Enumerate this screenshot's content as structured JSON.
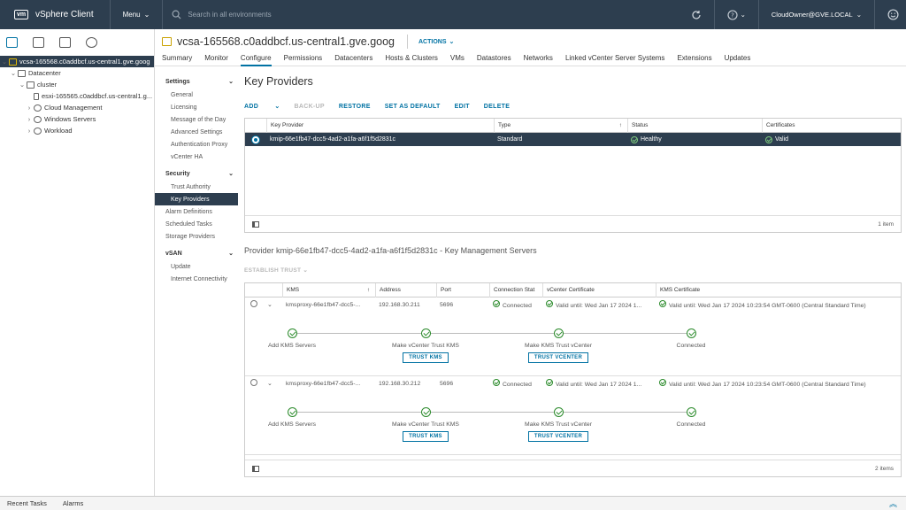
{
  "topbar": {
    "logo": "vm",
    "app_name": "vSphere Client",
    "menu_label": "Menu",
    "search_placeholder": "Search in all environments",
    "user": "CloudOwner@GVE.LOCAL"
  },
  "tree": {
    "items": [
      {
        "label": "vcsa-165568.c0addbcf.us-central1.gve.goog"
      },
      {
        "label": "Datacenter"
      },
      {
        "label": "cluster"
      },
      {
        "label": "esxi-165565.c0addbcf.us-central1.g..."
      },
      {
        "label": "Cloud Management"
      },
      {
        "label": "Windows Servers"
      },
      {
        "label": "Workload"
      }
    ]
  },
  "header": {
    "title": "vcsa-165568.c0addbcf.us-central1.gve.goog",
    "actions_label": "ACTIONS"
  },
  "tabs": [
    "Summary",
    "Monitor",
    "Configure",
    "Permissions",
    "Datacenters",
    "Hosts & Clusters",
    "VMs",
    "Datastores",
    "Networks",
    "Linked vCenter Server Systems",
    "Extensions",
    "Updates"
  ],
  "sidenav": {
    "settings_header": "Settings",
    "settings_items": [
      "General",
      "Licensing",
      "Message of the Day",
      "Advanced Settings",
      "Authentication Proxy",
      "vCenter HA"
    ],
    "security_header": "Security",
    "security_items": [
      "Trust Authority",
      "Key Providers"
    ],
    "other_items": [
      "Alarm Definitions",
      "Scheduled Tasks",
      "Storage Providers"
    ],
    "vsan_header": "vSAN",
    "vsan_items": [
      "Update",
      "Internet Connectivity"
    ]
  },
  "key_providers": {
    "title": "Key Providers",
    "buttons": {
      "add": "ADD",
      "backup": "BACK-UP",
      "restore": "RESTORE",
      "set_default": "SET AS DEFAULT",
      "edit": "EDIT",
      "delete": "DELETE"
    },
    "columns": [
      "Key Provider",
      "Type",
      "Status",
      "Certificates"
    ],
    "rows": [
      {
        "name": "kmip-66e1fb47-dcc5-4ad2-a1fa-a6f1f5d2831c",
        "type": "Standard",
        "status": "Healthy",
        "certificates": "Valid"
      }
    ],
    "count": "1 item"
  },
  "kms": {
    "title": "Provider kmip-66e1fb47-dcc5-4ad2-a1fa-a6f1f5d2831c - Key Management Servers",
    "establish_trust": "ESTABLISH TRUST",
    "columns": [
      "KMS",
      "Address",
      "Port",
      "Connection Stat",
      "vCenter Certificate",
      "KMS Certificate"
    ],
    "rows": [
      {
        "kms": "kmsproxy-66e1fb47-dcc5-...",
        "address": "192.168.30.211",
        "port": "5696",
        "connection": "Connected",
        "vc_cert": "Valid until: Wed Jan 17 2024 1...",
        "kms_cert": "Valid until: Wed Jan 17 2024 10:23:54 GMT-0600 (Central Standard Time)"
      },
      {
        "kms": "kmsproxy-66e1fb47-dcc5-...",
        "address": "192.168.30.212",
        "port": "5696",
        "connection": "Connected",
        "vc_cert": "Valid until: Wed Jan 17 2024 1...",
        "kms_cert": "Valid until: Wed Jan 17 2024 10:23:54 GMT-0600 (Central Standard Time)"
      }
    ],
    "steps": [
      "Add KMS Servers",
      "Make vCenter Trust KMS",
      "Make KMS Trust vCenter",
      "Connected"
    ],
    "trust_kms_label": "TRUST KMS",
    "trust_vcenter_label": "TRUST VCENTER",
    "count": "2 items"
  },
  "bottom": {
    "recent_tasks": "Recent Tasks",
    "alarms": "Alarms"
  }
}
